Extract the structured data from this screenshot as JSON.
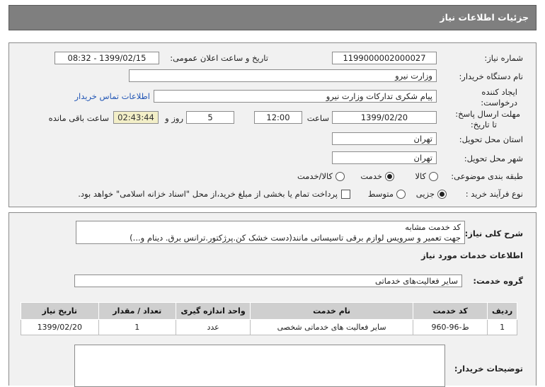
{
  "header": {
    "title": "جزئیات اطلاعات نیاز"
  },
  "tender": {
    "number_label": "شماره نیاز:",
    "number": "1199000002000027",
    "announce_label": "تاریخ و ساعت اعلان عمومی:",
    "announce": "1399/02/15 - 08:32",
    "buyer_label": "نام دستگاه خریدار:",
    "buyer": "وزارت نیرو",
    "creator_label_1": "ایجاد کننده",
    "creator_label_2": "درخواست:",
    "creator": "پیام شکری تدارکات وزارت نیرو",
    "contact_link": "اطلاعات تماس خریدار",
    "deadline_label_1": "مهلت ارسال پاسخ:",
    "deadline_label_2": "تا تاریخ:",
    "deadline_date": "1399/02/20",
    "time_label": "ساعت",
    "deadline_time": "12:00",
    "days_label": "روز و",
    "days": "5",
    "remaining": "02:43:44",
    "remaining_label": "ساعت باقی مانده",
    "province_label": "استان محل تحویل:",
    "province": "تهران",
    "city_label": "شهر محل تحویل:",
    "city": "تهران",
    "category_label": "طبقه بندی موضوعی:",
    "category_options": [
      "کالا",
      "خدمت",
      "کالا/خدمت"
    ],
    "category_selected": "خدمت",
    "process_label": "نوع فرآیند خرید :",
    "process_options": [
      "جزیی",
      "متوسط"
    ],
    "process_selected": "جزیی",
    "treasury_text": "پرداخت تمام یا بخشی از مبلغ خرید،از محل \"اسناد خزانه اسلامی\" خواهد بود."
  },
  "summary": {
    "label": "شرح کلی نیاز:",
    "line1": "کد خدمت مشابه",
    "line2": "جهت تعمیر و سرویس لوازم برقی تاسیساتی مانند(دست خشک کن.پرژکتور.ترانس برق. دینام و...)",
    "services_heading": "اطلاعات خدمات مورد نیاز",
    "group_label": "گروه خدمت:",
    "group_value": "سایر فعالیت‌های خدماتی"
  },
  "table": {
    "headers": [
      "ردیف",
      "کد خدمت",
      "نام خدمت",
      "واحد اندازه گیری",
      "تعداد / مقدار",
      "تاریخ نیاز"
    ],
    "rows": [
      [
        "1",
        "ط-96-960",
        "سایر فعالیت های خدماتی شخصی",
        "عدد",
        "1",
        "1399/02/20"
      ]
    ]
  },
  "notes": {
    "label": "توضیحات خریدار:",
    "value": ""
  }
}
